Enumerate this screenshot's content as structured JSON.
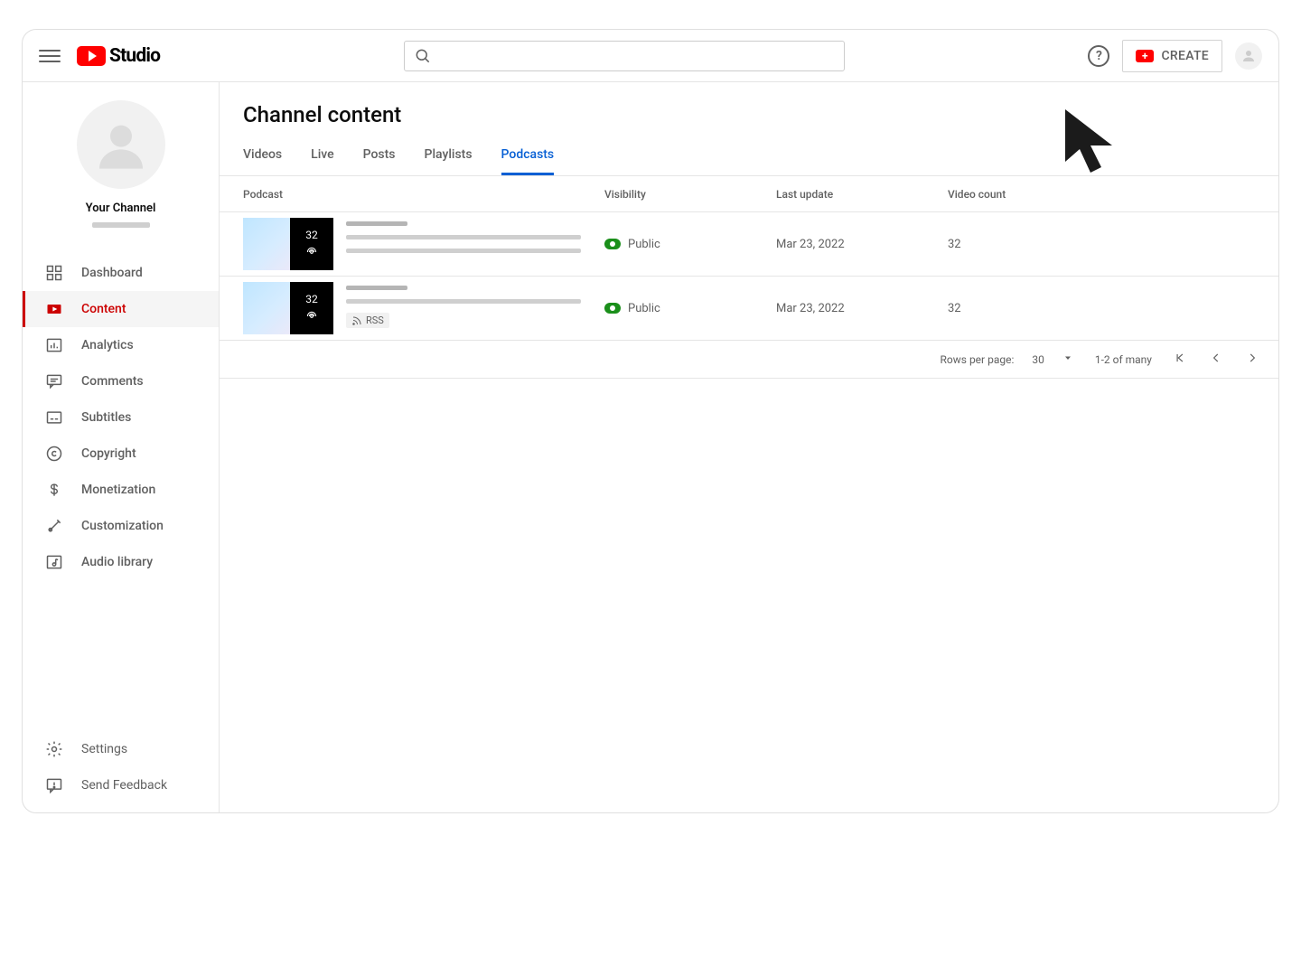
{
  "header": {
    "logo_text": "Studio",
    "search_placeholder": "",
    "create_label": "CREATE"
  },
  "sidebar": {
    "channel_name": "Your Channel",
    "items": [
      {
        "label": "Dashboard",
        "active": false
      },
      {
        "label": "Content",
        "active": true
      },
      {
        "label": "Analytics",
        "active": false
      },
      {
        "label": "Comments",
        "active": false
      },
      {
        "label": "Subtitles",
        "active": false
      },
      {
        "label": "Copyright",
        "active": false
      },
      {
        "label": "Monetization",
        "active": false
      },
      {
        "label": "Customization",
        "active": false
      },
      {
        "label": "Audio library",
        "active": false
      }
    ],
    "bottom_items": [
      {
        "label": "Settings"
      },
      {
        "label": "Send Feedback"
      }
    ]
  },
  "main": {
    "title": "Channel content",
    "tabs": [
      {
        "label": "Videos",
        "active": false
      },
      {
        "label": "Live",
        "active": false
      },
      {
        "label": "Posts",
        "active": false
      },
      {
        "label": "Playlists",
        "active": false
      },
      {
        "label": "Podcasts",
        "active": true
      }
    ],
    "columns": {
      "podcast": "Podcast",
      "visibility": "Visibility",
      "last_update": "Last update",
      "video_count": "Video count"
    },
    "rows": [
      {
        "episode_count": "32",
        "visibility": "Public",
        "last_update": "Mar 23, 2022",
        "video_count": "32",
        "has_rss": false
      },
      {
        "episode_count": "32",
        "visibility": "Public",
        "last_update": "Mar 23, 2022",
        "video_count": "32",
        "has_rss": true,
        "rss_label": "RSS"
      }
    ],
    "pagination": {
      "rows_label": "Rows per page:",
      "rows_value": "30",
      "range_text": "1-2 of many"
    }
  }
}
